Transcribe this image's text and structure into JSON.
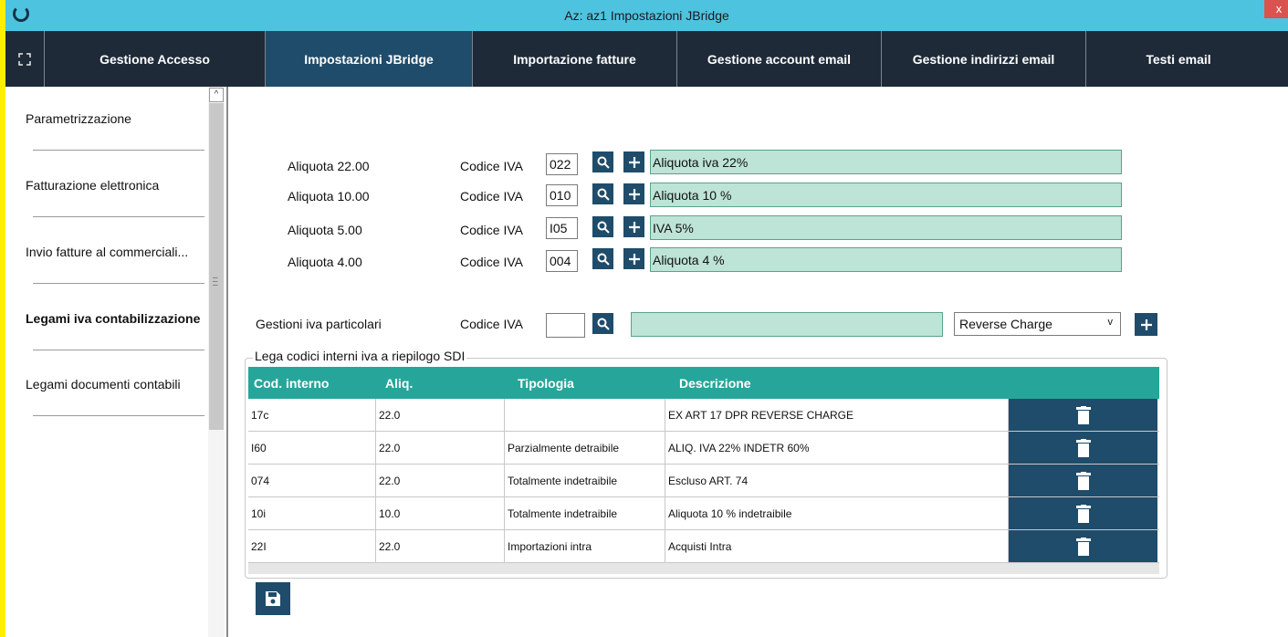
{
  "window": {
    "title": "Az: az1   Impostazioni JBridge",
    "close_label": "x"
  },
  "tabs": [
    {
      "label": "Gestione Accesso",
      "active": false
    },
    {
      "label": "Impostazioni JBridge",
      "active": true
    },
    {
      "label": "Importazione fatture",
      "active": false
    },
    {
      "label": "Gestione account email",
      "active": false
    },
    {
      "label": "Gestione indirizzi email",
      "active": false
    },
    {
      "label": "Testi email",
      "active": false
    }
  ],
  "sidebar": {
    "items": [
      {
        "label": "Parametrizzazione",
        "bold": false
      },
      {
        "label": "Fatturazione elettronica",
        "bold": false
      },
      {
        "label": "Invio fatture al commerciali...",
        "bold": false
      },
      {
        "label": "Legami iva contabilizzazione",
        "bold": true
      },
      {
        "label": "Legami documenti contabili",
        "bold": false
      }
    ]
  },
  "aliquote": [
    {
      "label": "Aliquota 22.00",
      "code_label": "Codice IVA",
      "code": "022",
      "description": "Aliquota iva 22%"
    },
    {
      "label": "Aliquota 10.00",
      "code_label": "Codice IVA",
      "code": "010",
      "description": "Aliquota 10 %"
    },
    {
      "label": "Aliquota 5.00",
      "code_label": "Codice IVA",
      "code": "I05",
      "description": "IVA 5%"
    },
    {
      "label": "Aliquota 4.00",
      "code_label": "Codice IVA",
      "code": "004",
      "description": "Aliquota  4 %"
    }
  ],
  "particolari": {
    "label": "Gestioni iva particolari",
    "code_label": "Codice IVA",
    "code": "",
    "description": "",
    "select_value": "Reverse Charge"
  },
  "legami": {
    "legend": "Lega codici interni iva  a riepilogo SDI",
    "columns": [
      "Cod. interno",
      "Aliq.",
      "Tipologia",
      "Descrizione"
    ],
    "rows": [
      {
        "codice": "17c",
        "aliq": "22.0",
        "tipologia": "",
        "descrizione": "EX ART 17 DPR REVERSE CHARGE"
      },
      {
        "codice": "I60",
        "aliq": "22.0",
        "tipologia": "Parzialmente detraibile",
        "descrizione": "ALIQ. IVA 22% INDETR 60%"
      },
      {
        "codice": "074",
        "aliq": "22.0",
        "tipologia": "Totalmente indetraibile",
        "descrizione": "Escluso  ART. 74"
      },
      {
        "codice": "10i",
        "aliq": "10.0",
        "tipologia": "Totalmente indetraibile",
        "descrizione": "Aliquota 10 % indetraibile"
      },
      {
        "codice": "22I",
        "aliq": "22.0",
        "tipologia": "Importazioni intra",
        "descrizione": "Acquisti Intra"
      }
    ]
  },
  "colors": {
    "tabbar": "#1e2a38",
    "accent": "#1f4c6a",
    "grid_header": "#26a69a",
    "desc_field": "#bde4d6",
    "titlebar": "#4ec3e0"
  }
}
